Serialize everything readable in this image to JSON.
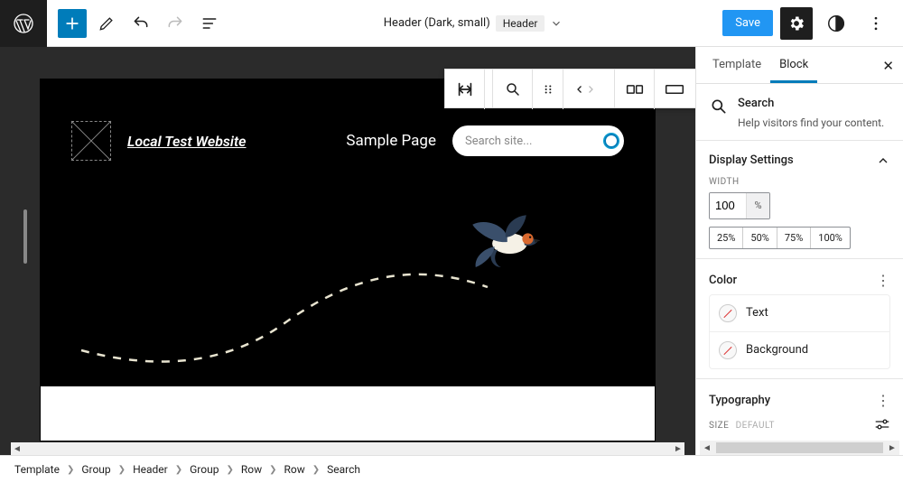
{
  "topbar": {
    "doc_title": "Header (Dark, small)",
    "doc_type_chip": "Header",
    "save_label": "Save"
  },
  "canvas": {
    "site_title": "Local Test Website",
    "nav_link": "Sample Page",
    "search_placeholder": "Search site..."
  },
  "sidebar": {
    "tabs": {
      "template": "Template",
      "block": "Block"
    },
    "block_panel": {
      "title": "Search",
      "description": "Help visitors find your content."
    },
    "display_settings": {
      "title": "Display Settings",
      "width_label": "Width",
      "width_value": "100",
      "width_unit": "%",
      "presets": [
        "25%",
        "50%",
        "75%",
        "100%"
      ]
    },
    "color": {
      "title": "Color",
      "rows": {
        "text": "Text",
        "background": "Background"
      }
    },
    "typography": {
      "title": "Typography",
      "size_label": "Size",
      "size_value": "Default"
    }
  },
  "breadcrumb": [
    "Template",
    "Group",
    "Header",
    "Group",
    "Row",
    "Row",
    "Search"
  ]
}
